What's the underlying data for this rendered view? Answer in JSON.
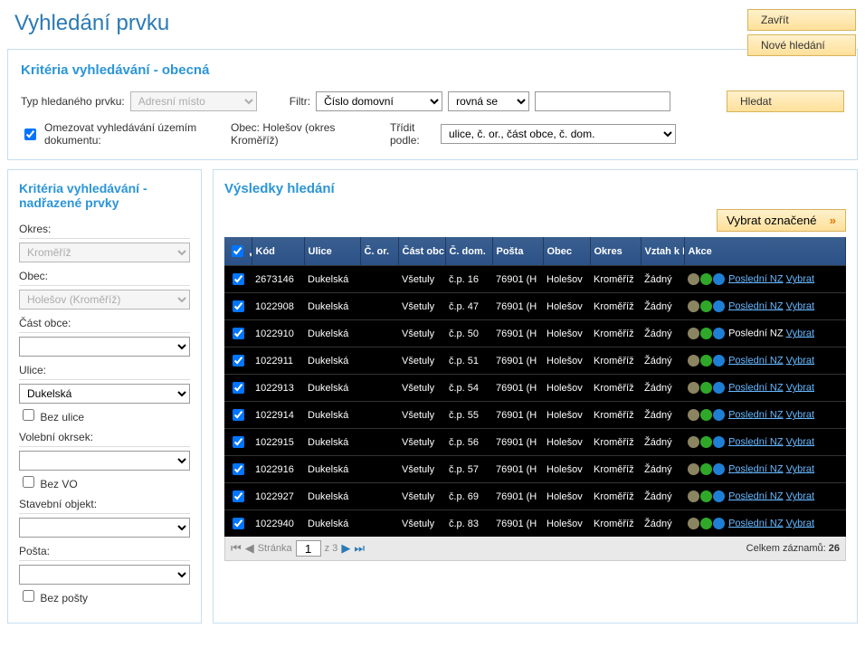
{
  "title": "Vyhledání prvku",
  "top_buttons": {
    "close": "Zavřít",
    "new_search": "Nové hledání"
  },
  "criteria": {
    "title": "Kritéria vyhledávání - obecná",
    "type_label": "Typ hledaného prvku:",
    "type_value": "Adresní místo",
    "filter_label": "Filtr:",
    "filter_field": "Číslo domovní",
    "filter_op": "rovná se",
    "filter_value": "",
    "search_btn": "Hledat",
    "limit_label": "Omezovat vyhledávání územím dokumentu:",
    "obec_label": "Obec: Holešov (okres Kroměříž)",
    "sort_label": "Třídit podle:",
    "sort_value": "ulice, č. or., část obce, č. dom."
  },
  "sidebar": {
    "title": "Kritéria vyhledávání - nadřazené prvky",
    "okres_label": "Okres:",
    "okres_value": "Kroměříž",
    "obec_label": "Obec:",
    "obec_value": "Holešov (Kroměříž)",
    "cast_label": "Část obce:",
    "cast_value": "",
    "ulice_label": "Ulice:",
    "ulice_value": "Dukelská",
    "bez_ulice": "Bez ulice",
    "vo_label": "Volební okrsek:",
    "vo_value": "",
    "bez_vo": "Bez VO",
    "so_label": "Stavební objekt:",
    "so_value": "",
    "posta_label": "Pošta:",
    "posta_value": "",
    "bez_posty": "Bez pošty"
  },
  "results": {
    "title": "Výsledky hledání",
    "select_marked": "Vybrat označené",
    "headers": [
      "Kód",
      "Ulice",
      "Č. or.",
      "Část obc",
      "Č. dom.",
      "Pošta",
      "Obec",
      "Okres",
      "Vztah k N",
      "Akce"
    ],
    "rows": [
      {
        "kod": "2673146",
        "ulice": "Dukelská",
        "cor": "",
        "cast": "Všetuly",
        "cdom": "č.p. 16",
        "posta": "76901 (H",
        "obec": "Holešov",
        "okres": "Kroměříž",
        "vztah": "Žádný",
        "nz_link": true
      },
      {
        "kod": "1022908",
        "ulice": "Dukelská",
        "cor": "",
        "cast": "Všetuly",
        "cdom": "č.p. 47",
        "posta": "76901 (H",
        "obec": "Holešov",
        "okres": "Kroměříž",
        "vztah": "Žádný",
        "nz_link": true
      },
      {
        "kod": "1022910",
        "ulice": "Dukelská",
        "cor": "",
        "cast": "Všetuly",
        "cdom": "č.p. 50",
        "posta": "76901 (H",
        "obec": "Holešov",
        "okres": "Kroměříž",
        "vztah": "Žádný",
        "nz_link": false
      },
      {
        "kod": "1022911",
        "ulice": "Dukelská",
        "cor": "",
        "cast": "Všetuly",
        "cdom": "č.p. 51",
        "posta": "76901 (H",
        "obec": "Holešov",
        "okres": "Kroměříž",
        "vztah": "Žádný",
        "nz_link": true
      },
      {
        "kod": "1022913",
        "ulice": "Dukelská",
        "cor": "",
        "cast": "Všetuly",
        "cdom": "č.p. 54",
        "posta": "76901 (H",
        "obec": "Holešov",
        "okres": "Kroměříž",
        "vztah": "Žádný",
        "nz_link": true
      },
      {
        "kod": "1022914",
        "ulice": "Dukelská",
        "cor": "",
        "cast": "Všetuly",
        "cdom": "č.p. 55",
        "posta": "76901 (H",
        "obec": "Holešov",
        "okres": "Kroměříž",
        "vztah": "Žádný",
        "nz_link": true
      },
      {
        "kod": "1022915",
        "ulice": "Dukelská",
        "cor": "",
        "cast": "Všetuly",
        "cdom": "č.p. 56",
        "posta": "76901 (H",
        "obec": "Holešov",
        "okres": "Kroměříž",
        "vztah": "Žádný",
        "nz_link": true
      },
      {
        "kod": "1022916",
        "ulice": "Dukelská",
        "cor": "",
        "cast": "Všetuly",
        "cdom": "č.p. 57",
        "posta": "76901 (H",
        "obec": "Holešov",
        "okres": "Kroměříž",
        "vztah": "Žádný",
        "nz_link": true
      },
      {
        "kod": "1022927",
        "ulice": "Dukelská",
        "cor": "",
        "cast": "Všetuly",
        "cdom": "č.p. 69",
        "posta": "76901 (H",
        "obec": "Holešov",
        "okres": "Kroměříž",
        "vztah": "Žádný",
        "nz_link": true
      },
      {
        "kod": "1022940",
        "ulice": "Dukelská",
        "cor": "",
        "cast": "Všetuly",
        "cdom": "č.p. 83",
        "posta": "76901 (H",
        "obec": "Holešov",
        "okres": "Kroměříž",
        "vztah": "Žádný",
        "nz_link": true
      }
    ],
    "action_nz": "Poslední NZ",
    "action_select": "Vybrat",
    "pager": {
      "label": "Stránka",
      "page": "1",
      "of": "z 3",
      "total_label": "Celkem záznamů:",
      "total": "26"
    }
  }
}
